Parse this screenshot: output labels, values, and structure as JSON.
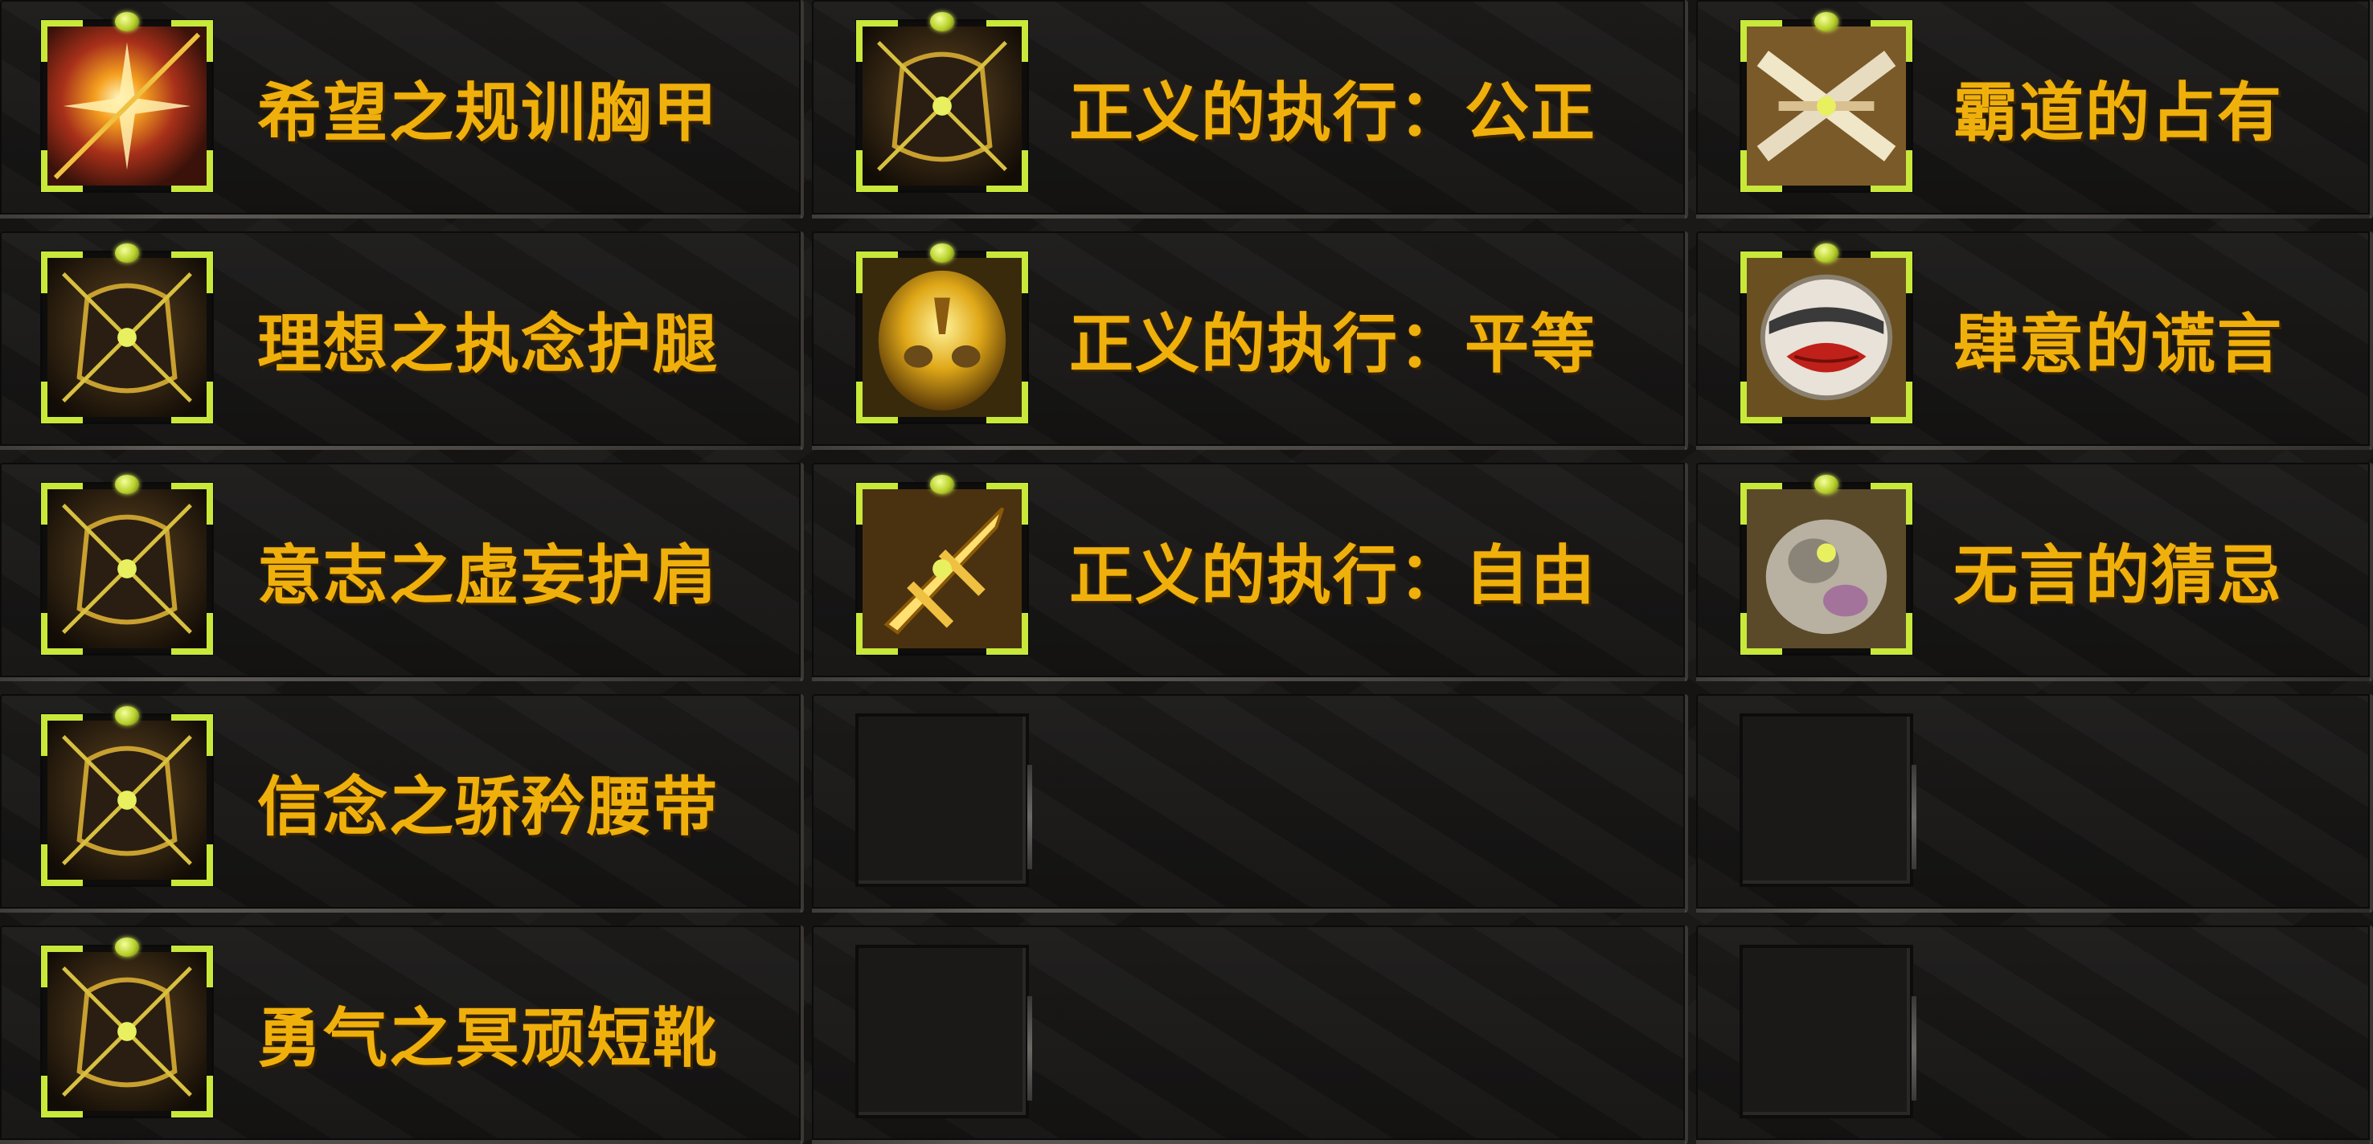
{
  "items": [
    {
      "name": "希望之规训胸甲",
      "icon": "chest-armor-icon",
      "art": "red"
    },
    {
      "name": "理想之执念护腿",
      "icon": "leg-armor-icon",
      "art": "dark"
    },
    {
      "name": "意志之虚妄护肩",
      "icon": "shoulder-armor-icon",
      "art": "dark"
    },
    {
      "name": "信念之骄矜腰带",
      "icon": "belt-icon",
      "art": "dark"
    },
    {
      "name": "勇气之冥顽短靴",
      "icon": "boots-icon",
      "art": "dark"
    },
    {
      "name": "正义的执行：公正",
      "icon": "dark-orb-icon",
      "art": "dark"
    },
    {
      "name": "正义的执行：平等",
      "icon": "golden-mask-icon",
      "art": "gold"
    },
    {
      "name": "正义的执行：自由",
      "icon": "golden-sword-icon",
      "art": "sword"
    },
    {
      "name": "霸道的占有",
      "icon": "crossed-blades-icon",
      "art": "blades"
    },
    {
      "name": "肆意的谎言",
      "icon": "lips-mask-icon",
      "art": "lips"
    },
    {
      "name": "无言的猜忌",
      "icon": "stone-fist-icon",
      "art": "stone"
    }
  ],
  "colors": {
    "text": "#f0b00c",
    "frame": "#c8e83a",
    "background": "#171615"
  }
}
